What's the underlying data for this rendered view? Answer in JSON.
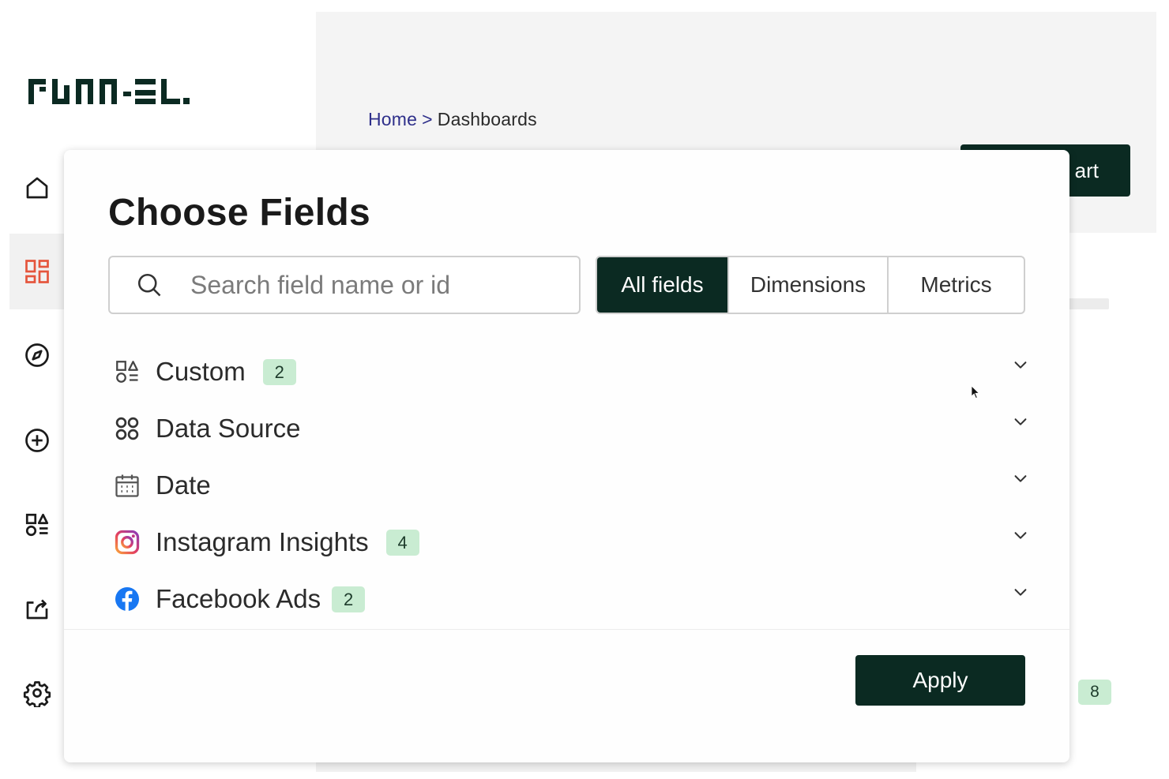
{
  "brand": {
    "logo_text": "FUNNEL"
  },
  "breadcrumb": {
    "home": "Home",
    "separator": ">",
    "current": "Dashboards"
  },
  "background": {
    "button_partial_label": "art",
    "badge_count": "8"
  },
  "sidebar": {
    "items": [
      {
        "icon": "home-icon",
        "active": false
      },
      {
        "icon": "dashboards-icon",
        "active": true,
        "accent": "#e5553c"
      },
      {
        "icon": "explore-compass-icon",
        "active": false
      },
      {
        "icon": "add-circle-icon",
        "active": false
      },
      {
        "icon": "custom-fields-icon",
        "active": false
      },
      {
        "icon": "export-share-icon",
        "active": false
      },
      {
        "icon": "settings-gear-icon",
        "active": false
      }
    ]
  },
  "modal": {
    "title": "Choose Fields",
    "search": {
      "placeholder": "Search field name or id",
      "value": ""
    },
    "filters": {
      "selected": "All fields",
      "options": [
        "All fields",
        "Dimensions",
        "Metrics"
      ]
    },
    "groups": [
      {
        "label": "Custom",
        "count": "2",
        "icon": "custom-fields-icon"
      },
      {
        "label": "Data Source",
        "count": "",
        "icon": "data-source-grid-icon"
      },
      {
        "label": "Date",
        "count": "",
        "icon": "calendar-icon"
      },
      {
        "label": "Instagram Insights",
        "count": "4",
        "icon": "instagram-icon"
      },
      {
        "label": "Facebook Ads",
        "count": "2",
        "icon": "facebook-icon"
      }
    ],
    "apply_label": "Apply"
  },
  "colors": {
    "primary_dark": "#0b2a22",
    "badge_bg": "#c9ecd2",
    "accent_orange": "#e5553c",
    "link_blue": "#2e2f8a",
    "facebook_blue": "#1877f2"
  }
}
